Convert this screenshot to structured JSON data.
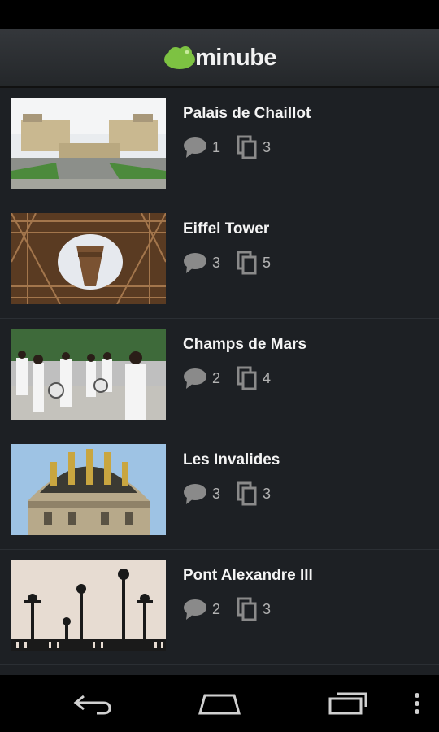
{
  "app": {
    "name": "minube",
    "brand_color": "#7dc242"
  },
  "places": [
    {
      "name": "Palais de Chaillot",
      "comments": "1",
      "photos": "3"
    },
    {
      "name": "Eiffel Tower",
      "comments": "3",
      "photos": "5"
    },
    {
      "name": "Champs de Mars",
      "comments": "2",
      "photos": "4"
    },
    {
      "name": "Les Invalides",
      "comments": "3",
      "photos": "3"
    },
    {
      "name": "Pont Alexandre III",
      "comments": "2",
      "photos": "3"
    }
  ],
  "icons": {
    "comment": "comment-icon",
    "photos": "photos-icon",
    "back": "back-icon",
    "home": "home-icon",
    "recents": "recents-icon",
    "menu": "overflow-menu-icon"
  }
}
